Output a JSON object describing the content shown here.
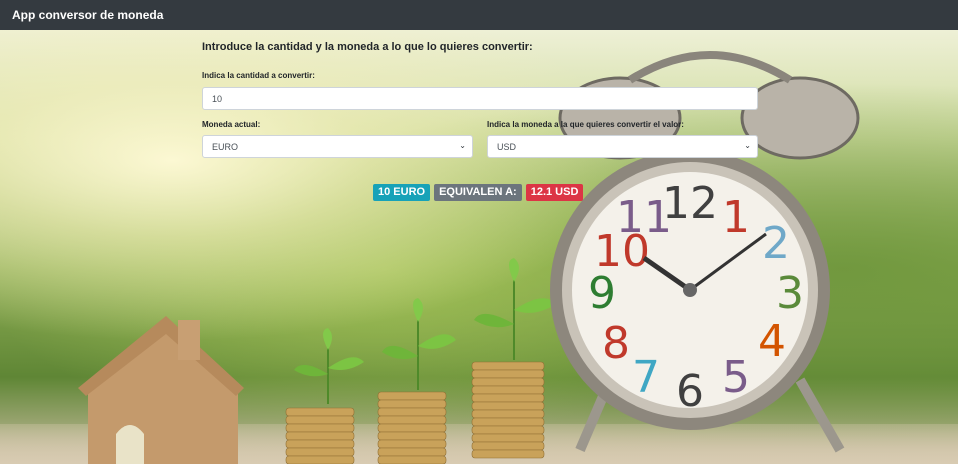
{
  "app": {
    "title": "App conversor de moneda"
  },
  "form": {
    "heading": "Introduce la cantidad y la moneda a lo que lo quieres convertir:",
    "amount_label": "Indica la cantidad a convertir:",
    "amount_value": "10",
    "from_label": "Moneda actual:",
    "from_value": "EURO",
    "to_label": "Indica la moneda a la que quieres convertir el valor:",
    "to_value": "USD"
  },
  "result": {
    "from_badge": "10 EURO",
    "equals_badge": "EQUIVALEN A:",
    "to_badge": "12.1 USD"
  },
  "colors": {
    "navbar": "#343a40",
    "badge_info": "#17a2b8",
    "badge_secondary": "#6c757d",
    "badge_danger": "#dc3545"
  }
}
